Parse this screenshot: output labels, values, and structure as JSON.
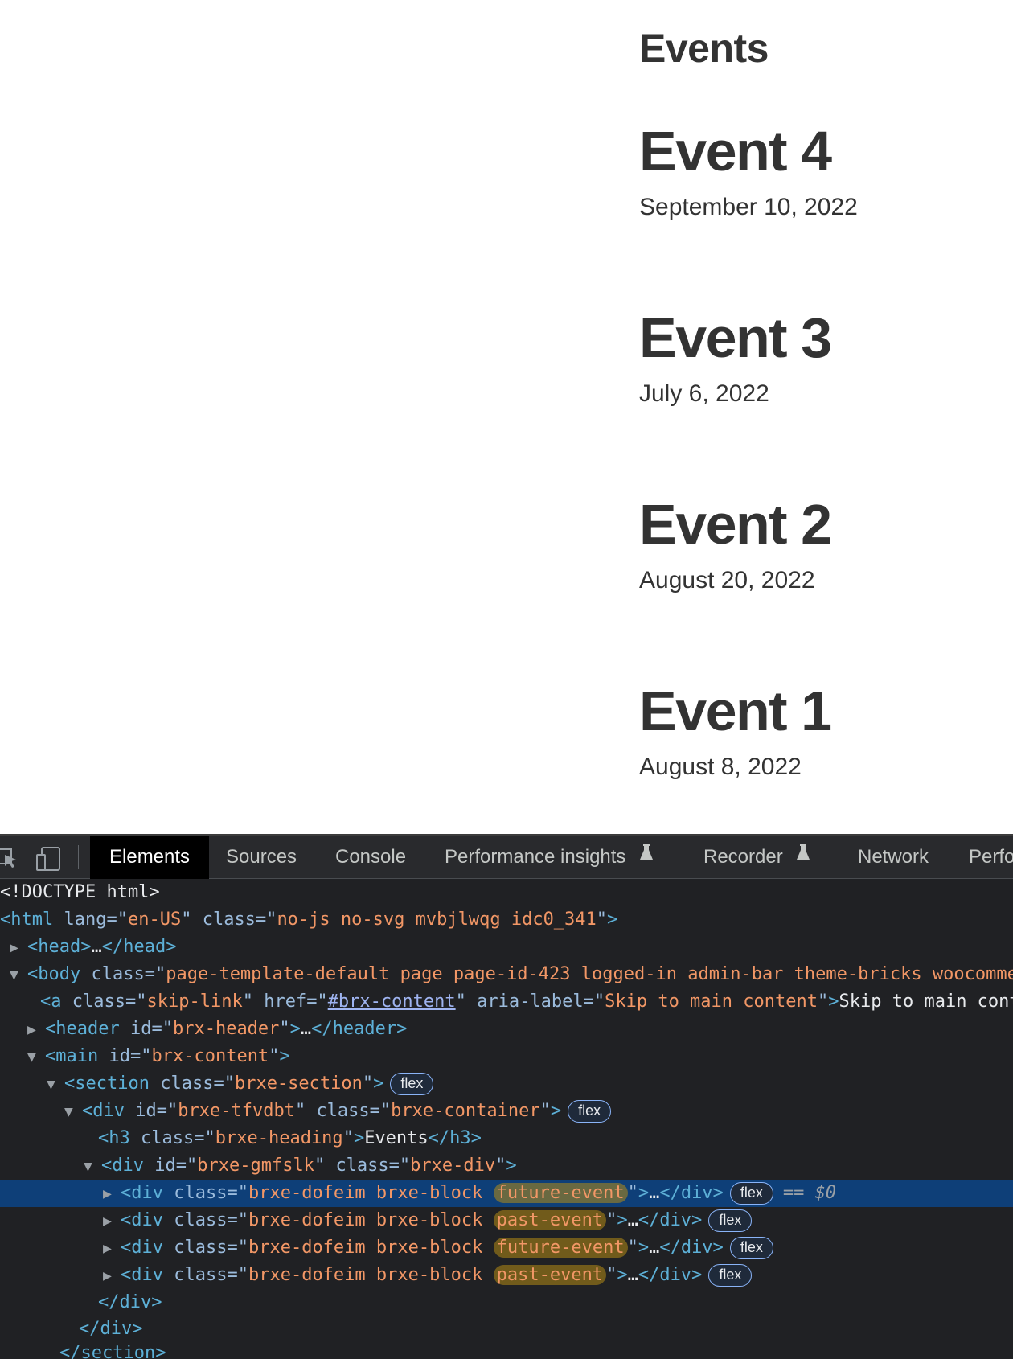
{
  "page": {
    "heading": "Events",
    "events": [
      {
        "name": "Event 4",
        "date": "September 10, 2022"
      },
      {
        "name": "Event 3",
        "date": "July 6, 2022"
      },
      {
        "name": "Event 2",
        "date": "August 20, 2022"
      },
      {
        "name": "Event 1",
        "date": "August 8, 2022"
      }
    ]
  },
  "devtools": {
    "tabs": [
      {
        "label": "Elements",
        "active": true
      },
      {
        "label": "Sources"
      },
      {
        "label": "Console"
      },
      {
        "label": "Performance insights",
        "flask": true
      },
      {
        "label": "Recorder",
        "flask": true
      },
      {
        "label": "Network"
      },
      {
        "label": "Perfo"
      }
    ],
    "tree": {
      "doctype": "<!DOCTYPE html>",
      "html_tag": "html",
      "html_lang_attr": "lang",
      "html_lang": "en-US",
      "html_class": "no-js no-svg mvbjlwqg idc0_341",
      "head_open": "<head>",
      "head_close": "</head>",
      "ellipsis": "…",
      "body_class": "page-template-default page page-id-423 logged-in admin-bar theme-bricks woocomme",
      "a_class": "skip-link",
      "a_href": "#brx-content",
      "a_aria_label": "Skip to main content",
      "a_text": "Skip to main cont",
      "header_id": "brx-header",
      "main_id": "brx-content",
      "section_class": "brxe-section",
      "container_id": "brxe-tfvdbt",
      "container_class": "brxe-container",
      "h3_class": "brxe-heading",
      "h3_text": "Events",
      "div_id": "brxe-gmfslk",
      "div_class": "brxe-div",
      "block_class_prefix": "brxe-dofeim brxe-block",
      "blocks": [
        "future-event",
        "past-event",
        "future-event",
        "past-event"
      ],
      "badge": "flex",
      "selected_marker": "== $0",
      "close_div": "</div>",
      "close_section": "</section>"
    }
  }
}
